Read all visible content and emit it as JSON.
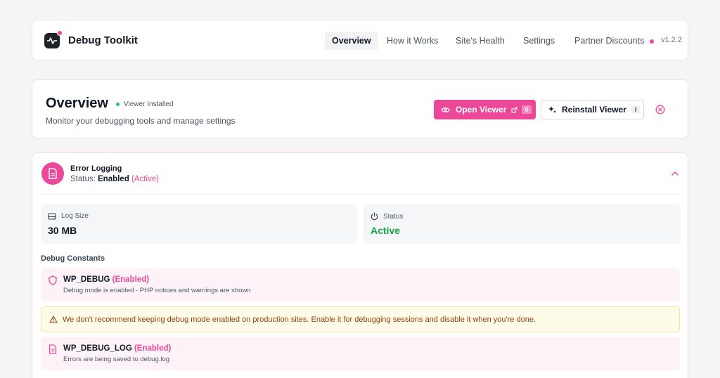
{
  "header": {
    "brand": "Debug Toolkit",
    "nav": [
      {
        "label": "Overview",
        "active": true
      },
      {
        "label": "How it Works"
      },
      {
        "label": "Site's Health"
      },
      {
        "label": "Settings"
      },
      {
        "label": "Partner Discounts"
      }
    ],
    "version": "v1.2.2",
    "logo_icon": "pulse-icon"
  },
  "overview": {
    "title": "Overview",
    "badge": "Viewer Installed",
    "subtitle": "Monitor your debugging tools and manage settings",
    "open_viewer": {
      "label": "Open Viewer",
      "count": "0",
      "icons": [
        "eye-icon",
        "external-link-icon"
      ]
    },
    "reinstall_viewer": {
      "label": "Reinstall Viewer",
      "count": "I",
      "icon": "sparkle-icon"
    },
    "close_icon": "close-circle-icon"
  },
  "error_logging": {
    "title": "Error Logging",
    "status_prefix": "Status: ",
    "status_value": "Enabled",
    "status_suffix": "(Active)",
    "icon": "document-icon",
    "stats": [
      {
        "label": "Log Size",
        "value": "30 MB",
        "icon": "drive-icon"
      },
      {
        "label": "Status",
        "value": "Active",
        "icon": "power-icon"
      }
    ],
    "constants_title": "Debug Constants",
    "constants": [
      {
        "name": "WP_DEBUG",
        "state": "(Enabled)",
        "desc": "Debug mode is enabled - PHP notices and warnings are shown",
        "icon": "shield-icon"
      },
      {
        "name": "WP_DEBUG_LOG",
        "state": "(Enabled)",
        "desc": "Errors are being saved to debug.log",
        "icon": "file-icon"
      }
    ],
    "warning": "We don't recommend keeping debug mode enabled on production sites. Enable it for debugging sessions and disable it when you're done.",
    "warning_icon": "warning-icon"
  },
  "colors": {
    "accent": "#ec4899",
    "success": "#16a34a",
    "warning_bg": "#fefbe8"
  }
}
